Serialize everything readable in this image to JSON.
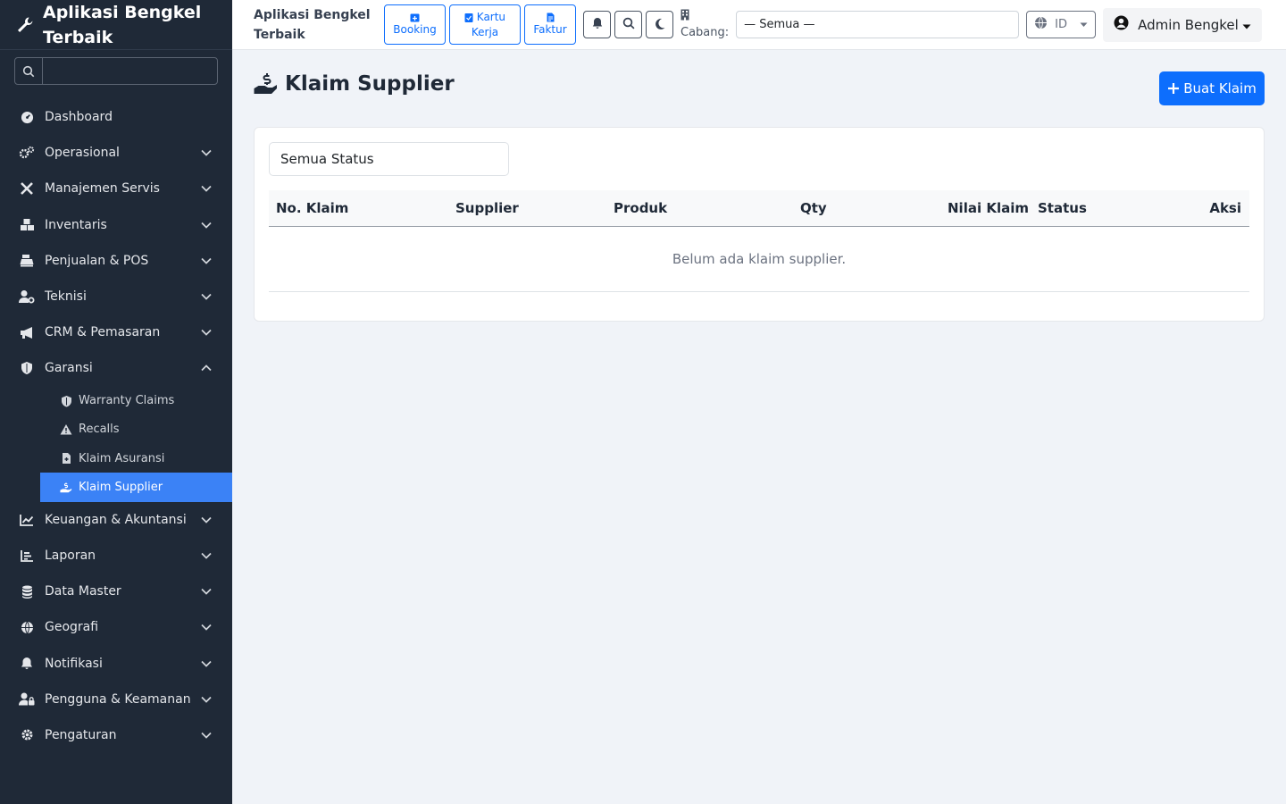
{
  "app": {
    "title": "Aplikasi Bengkel Terbaik",
    "title_line1": "Aplikasi Bengkel",
    "title_line2": "Terbaik"
  },
  "sidebar": {
    "search_placeholder": "",
    "items": [
      {
        "label": "Dashboard",
        "icon": "gauge-icon"
      },
      {
        "label": "Operasional",
        "icon": "cogs-icon"
      },
      {
        "label": "Manajemen Servis",
        "icon": "tools-icon"
      },
      {
        "label": "Inventaris",
        "icon": "boxes-icon"
      },
      {
        "label": "Penjualan & POS",
        "icon": "cash-register-icon"
      },
      {
        "label": "Teknisi",
        "icon": "user-gear-icon"
      },
      {
        "label": "CRM & Pemasaran",
        "icon": "megaphone-icon"
      },
      {
        "label": "Garansi",
        "icon": "shield-icon"
      },
      {
        "label": "Keuangan & Akuntansi",
        "icon": "line-chart-icon"
      },
      {
        "label": "Laporan",
        "icon": "bar-chart-icon"
      },
      {
        "label": "Data Master",
        "icon": "database-icon"
      },
      {
        "label": "Geografi",
        "icon": "globe-icon"
      },
      {
        "label": "Notifikasi",
        "icon": "bell-icon"
      },
      {
        "label": "Pengguna & Keamanan",
        "icon": "user-lock-icon"
      },
      {
        "label": "Pengaturan",
        "icon": "gear-icon"
      }
    ],
    "garansi_sub": [
      {
        "label": "Warranty Claims",
        "icon": "shield-check-icon"
      },
      {
        "label": "Recalls",
        "icon": "warning-icon"
      },
      {
        "label": "Klaim Asuransi",
        "icon": "file-medical-icon"
      },
      {
        "label": "Klaim Supplier",
        "icon": "hand-dollar-icon",
        "active": true
      }
    ]
  },
  "topbar": {
    "quick_buttons": [
      {
        "label": "Booking"
      },
      {
        "label_line1": "Kartu",
        "label_line2": "Kerja"
      },
      {
        "label": "Faktur"
      }
    ],
    "cabang_label": "Cabang:",
    "cabang_value": "— Semua —",
    "language": "ID",
    "user": "Admin Bengkel"
  },
  "page": {
    "title": "Klaim Supplier",
    "create_button": "Buat Klaim",
    "status_filter": "Semua Status",
    "table": {
      "headers": [
        "No. Klaim",
        "Supplier",
        "Produk",
        "Qty",
        "Nilai Klaim",
        "Status",
        "Aksi"
      ],
      "rows": [],
      "empty_message": "Belum ada klaim supplier."
    }
  }
}
